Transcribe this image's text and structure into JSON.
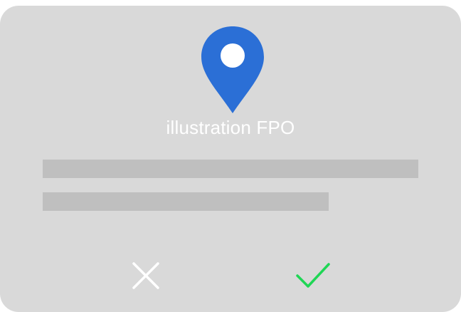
{
  "illustration": {
    "label": "illustration FPO",
    "icon": "map-pin-icon",
    "icon_color": "#2b6fd6"
  },
  "actions": {
    "cancel_icon": "close-icon",
    "cancel_color": "#ffffff",
    "confirm_icon": "checkmark-icon",
    "confirm_color": "#1fd655"
  },
  "colors": {
    "card_background": "#d9d9d9",
    "placeholder_bar": "#bfbfbf"
  }
}
